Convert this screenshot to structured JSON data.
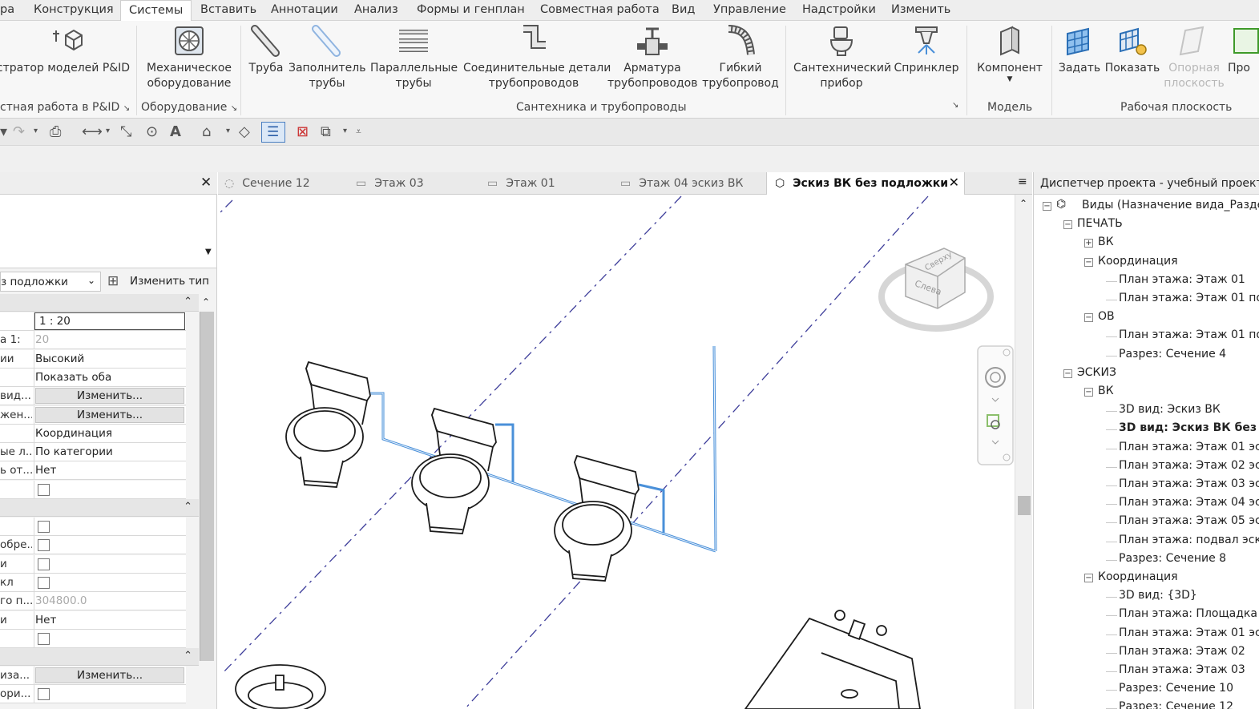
{
  "menu_tabs": [
    "ра",
    "Конструкция",
    "Системы",
    "Вставить",
    "Аннотации",
    "Анализ",
    "Формы и генплан",
    "Совместная работа",
    "Вид",
    "Управление",
    "Надстройки",
    "Изменить"
  ],
  "ribbon": {
    "buttons": [
      {
        "name": "pid-modeler",
        "line1": "стратор моделей P&ID",
        "line2": ""
      },
      {
        "name": "mech-equip",
        "line1": "Механическое",
        "line2": "оборудование"
      },
      {
        "name": "pipe",
        "line1": "Труба",
        "line2": ""
      },
      {
        "name": "pipe-placeholder",
        "line1": "Заполнитель",
        "line2": "трубы"
      },
      {
        "name": "parallel-pipes",
        "line1": "Параллельные",
        "line2": "трубы"
      },
      {
        "name": "pipe-fittings",
        "line1": "Соединительные детали",
        "line2": "трубопроводов"
      },
      {
        "name": "pipe-accessory",
        "line1": "Арматура",
        "line2": "трубопроводов"
      },
      {
        "name": "flex-pipe",
        "line1": "Гибкий",
        "line2": "трубопровод"
      },
      {
        "name": "plumbing-fixture",
        "line1": "Сантехнический",
        "line2": "прибор"
      },
      {
        "name": "sprinkler",
        "line1": "Спринклер",
        "line2": ""
      },
      {
        "name": "component",
        "line1": "Компонент",
        "line2": ""
      },
      {
        "name": "set",
        "line1": "Задать",
        "line2": ""
      },
      {
        "name": "show",
        "line1": "Показать",
        "line2": ""
      },
      {
        "name": "ref-plane",
        "line1": "Опорная",
        "line2": "плоскость"
      },
      {
        "name": "pro",
        "line1": "Про",
        "line2": ""
      }
    ],
    "panels": [
      "стная работа в P&ID",
      "Оборудование",
      "Сантехника и трубопроводы",
      "Модель",
      "Рабочая плоскость"
    ]
  },
  "properties": {
    "view_type_selector": "з подложки",
    "edit_type_label": "Изменить тип",
    "rows": [
      {
        "k": "",
        "v": "1 : 20",
        "type": "input"
      },
      {
        "k": "а    1:",
        "v": "20",
        "type": "gray"
      },
      {
        "k": "ии",
        "v": "Высокий",
        "type": "text"
      },
      {
        "k": "",
        "v": "Показать оба",
        "type": "text"
      },
      {
        "k": "вид...",
        "v": "Изменить...",
        "type": "button"
      },
      {
        "k": "жен...",
        "v": "Изменить...",
        "type": "button"
      },
      {
        "k": "",
        "v": "Координация",
        "type": "text"
      },
      {
        "k": "ые л...",
        "v": "По категории",
        "type": "text"
      },
      {
        "k": "ь от...",
        "v": "Нет",
        "type": "text"
      },
      {
        "k": "",
        "v": "",
        "type": "check"
      }
    ],
    "rows2": [
      {
        "k": "",
        "v": "",
        "type": "check"
      },
      {
        "k": "обре...",
        "v": "",
        "type": "check"
      },
      {
        "k": "и",
        "v": "",
        "type": "check"
      },
      {
        "k": "кл",
        "v": "",
        "type": "check"
      },
      {
        "k": "го п...",
        "v": "304800.0",
        "type": "gray"
      },
      {
        "k": "и",
        "v": "Нет",
        "type": "text"
      },
      {
        "k": "",
        "v": "",
        "type": "check"
      }
    ],
    "rows3": [
      {
        "k": "иза...",
        "v": "Изменить...",
        "type": "button"
      },
      {
        "k": "ори...",
        "v": "",
        "type": "check"
      }
    ]
  },
  "view_tabs": [
    {
      "label": "Сечение 12",
      "active": false
    },
    {
      "label": "Этаж 03",
      "active": false
    },
    {
      "label": "Этаж 01",
      "active": false
    },
    {
      "label": "Этаж 04 эскиз ВК",
      "active": false
    },
    {
      "label": "Эскиз ВК без подложки",
      "active": true
    }
  ],
  "viewcube": {
    "face_front": "Слева",
    "face_top": "Сверху"
  },
  "browser": {
    "title": "Диспетчер проекта - учебный проект",
    "nodes": [
      {
        "label": "Виды (Назначение вида_Разде",
        "level": 0,
        "toggle": "−"
      },
      {
        "label": "ПЕЧАТЬ",
        "level": 1,
        "toggle": "−"
      },
      {
        "label": "ВК",
        "level": 2,
        "toggle": "+"
      },
      {
        "label": "Координация",
        "level": 2,
        "toggle": "−"
      },
      {
        "label": "План этажа: Этаж 01",
        "level": 3
      },
      {
        "label": "План этажа: Этаж 01 по",
        "level": 3
      },
      {
        "label": "ОВ",
        "level": 2,
        "toggle": "−"
      },
      {
        "label": "План этажа: Этаж 01 по",
        "level": 3
      },
      {
        "label": "Разрез: Сечение 4",
        "level": 3
      },
      {
        "label": "ЭСКИЗ",
        "level": 1,
        "toggle": "−"
      },
      {
        "label": "ВК",
        "level": 2,
        "toggle": "−"
      },
      {
        "label": "3D вид: Эскиз ВК",
        "level": 3
      },
      {
        "label": "3D вид: Эскиз ВК без",
        "level": 3,
        "selected": true
      },
      {
        "label": "План этажа: Этаж 01 эс",
        "level": 3
      },
      {
        "label": "План этажа: Этаж 02 эс",
        "level": 3
      },
      {
        "label": "План этажа: Этаж 03 эс",
        "level": 3
      },
      {
        "label": "План этажа: Этаж 04 эс",
        "level": 3
      },
      {
        "label": "План этажа: Этаж 05 эс",
        "level": 3
      },
      {
        "label": "План этажа: подвал эск",
        "level": 3
      },
      {
        "label": "Разрез: Сечение 8",
        "level": 3
      },
      {
        "label": "Координация",
        "level": 2,
        "toggle": "−"
      },
      {
        "label": "3D вид: {3D}",
        "level": 3
      },
      {
        "label": "План этажа: Площадка",
        "level": 3
      },
      {
        "label": "План этажа: Этаж 01 эс",
        "level": 3
      },
      {
        "label": "План этажа: Этаж 02",
        "level": 3
      },
      {
        "label": "План этажа: Этаж 03",
        "level": 3
      },
      {
        "label": "Разрез: Сечение 10",
        "level": 3
      },
      {
        "label": "Разрез: Сечение 12",
        "level": 3
      }
    ]
  },
  "colors": {
    "pipe": "#4a90d9",
    "accent": "#1e5aa8"
  }
}
